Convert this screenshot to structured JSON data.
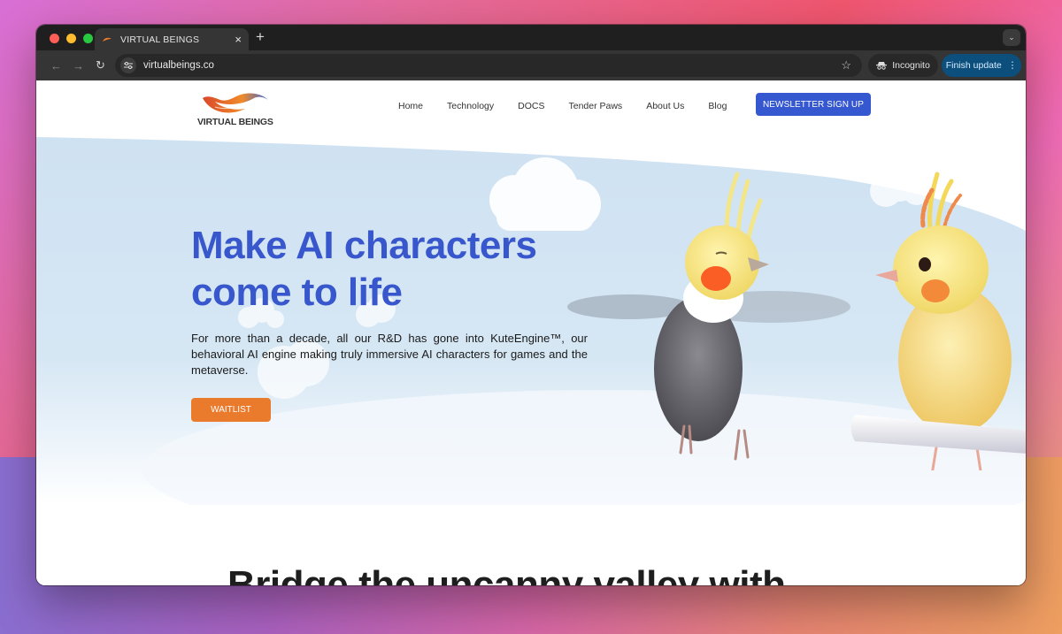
{
  "browser": {
    "tab": {
      "title": "VIRTUAL BEINGS",
      "close_icon": "×"
    },
    "new_tab_icon": "+",
    "tab_menu_icon": "⌄",
    "nav": {
      "back_icon": "←",
      "forward_icon": "→",
      "reload_icon": "↻"
    },
    "url": "virtualbeings.co",
    "bookmark_icon": "☆",
    "incognito_label": "Incognito",
    "finish_update_label": "Finish update",
    "menu_icon": "⋮",
    "traffic_lights": {
      "close": "#ff5f57",
      "minimize": "#febc2e",
      "maximize": "#28c840"
    }
  },
  "site": {
    "logo_text": "VIRTUAL BEINGS",
    "nav": [
      "Home",
      "Technology",
      "DOCS",
      "Tender Paws",
      "About Us",
      "Blog"
    ],
    "newsletter_label": "NEWSLETTER SIGN UP",
    "hero": {
      "headline_line1": "Make AI characters",
      "headline_line2": "come to life",
      "body": "For more than a decade, all our R&D has gone into KuteEngine™, our behavioral AI engine making truly immersive AI characters for games and the metaverse.",
      "cta_label": "WAITLIST"
    },
    "next_section_heading": "Bridge the uncanny valley with",
    "colors": {
      "brand_blue": "#3857cc",
      "cta_orange": "#ea7a2c",
      "sky": "#d3e5f3"
    }
  }
}
